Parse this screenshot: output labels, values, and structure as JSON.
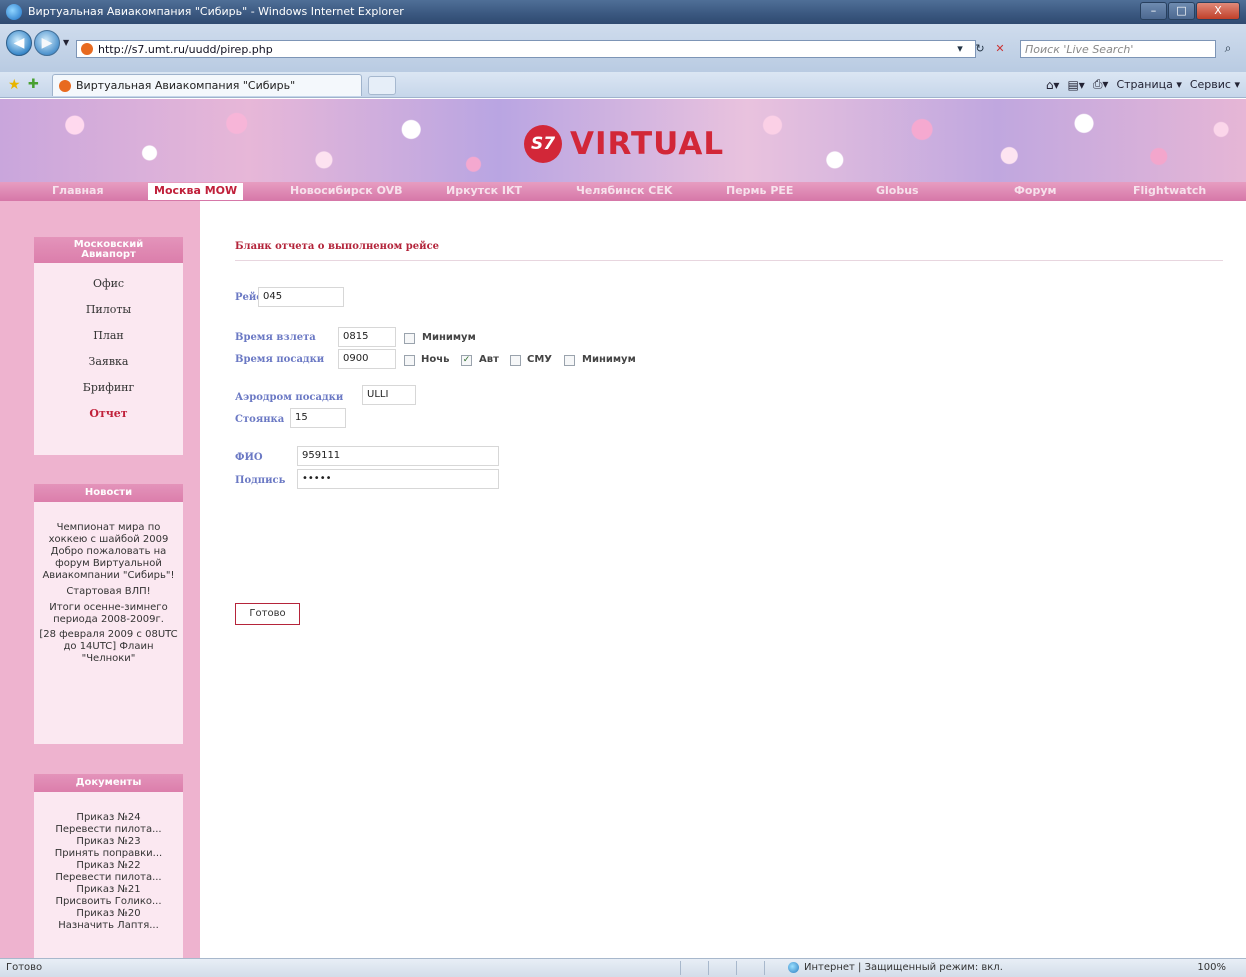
{
  "window": {
    "title": "Виртуальная Авиакомпания \"Сибирь\" - Windows Internet Explorer",
    "min": "–",
    "max": "□",
    "close": "X"
  },
  "addressbar": {
    "url": "http://s7.umt.ru/uudd/pirep.php",
    "search_placeholder": "Поиск 'Live Search'"
  },
  "tabs": {
    "active_label": "Виртуальная Авиакомпания \"Сибирь\"",
    "cmd_page": "Страница ▾",
    "cmd_tools": "Сервис ▾"
  },
  "site": {
    "logo_mark": "S7",
    "logo_text": "VIRTUAL",
    "nav": [
      {
        "label": "Главная"
      },
      {
        "label": "Москва MOW"
      },
      {
        "label": "Новосибирск OVB"
      },
      {
        "label": "Иркутск IKT"
      },
      {
        "label": "Челябинск CEK"
      },
      {
        "label": "Пермь PEE"
      },
      {
        "label": "Globus"
      },
      {
        "label": "Форум"
      },
      {
        "label": "Flightwatch"
      }
    ]
  },
  "sidebar": {
    "hub_title_1": "Московский",
    "hub_title_2": "Авиапорт",
    "menu": [
      "Офис",
      "Пилоты",
      "План",
      "Заявка",
      "Брифинг",
      "Отчет"
    ],
    "news_title": "Новости",
    "news": [
      "Чемпионат мира по хоккею с шайбой 2009",
      "Добро пожаловать на форум Виртуальной Авиакомпании \"Сибирь\"!",
      "Стартовая ВЛП!",
      "Итоги осенне-зимнего периода 2008-2009г.",
      "[28 февраля 2009 с 08UTC до 14UTC] Флаин \"Челноки\""
    ],
    "docs_title": "Документы",
    "docs": [
      {
        "title": "Приказ №24",
        "text": "Перевести пилота..."
      },
      {
        "title": "Приказ №23",
        "text": "Принять поправки..."
      },
      {
        "title": "Приказ №22",
        "text": "Перевести пилота..."
      },
      {
        "title": "Приказ №21",
        "text": "Присвоить Голико..."
      },
      {
        "title": "Приказ №20",
        "text": "Назначить Лаптя..."
      }
    ]
  },
  "form": {
    "title": "Бланк отчета о выполненом рейсе",
    "flight_label": "Рейс",
    "flight_value": "045",
    "takeoff_label": "Время взлета",
    "takeoff_value": "0815",
    "takeoff_min_label": "Минимум",
    "landing_label": "Время посадки",
    "landing_value": "0900",
    "night_label": "Ночь",
    "auto_label": "Авт",
    "auto_checked": true,
    "smu_label": "СМУ",
    "landing_min_label": "Минимум",
    "airport_label": "Аэродром посадки",
    "airport_value": "ULLI",
    "stand_label": "Стоянка",
    "stand_value": "15",
    "name_label": "ФИО",
    "name_value": "959111",
    "sign_label": "Подпись",
    "sign_value": "•••••",
    "submit_label": "Готово"
  },
  "statusbar": {
    "status": "Готово",
    "zone": "Интернет | Защищенный режим: вкл.",
    "zoom": "100%"
  }
}
